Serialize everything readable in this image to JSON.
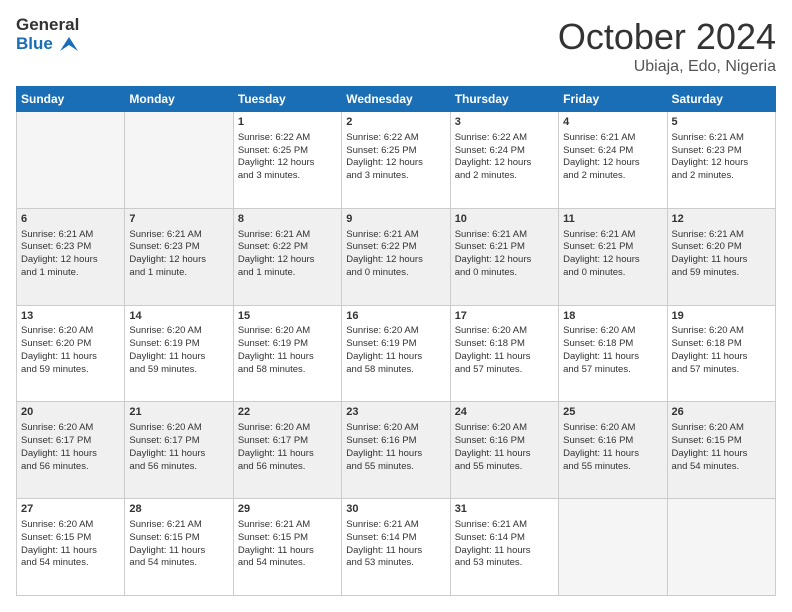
{
  "header": {
    "logo_line1": "General",
    "logo_line2": "Blue",
    "month": "October 2024",
    "location": "Ubiaja, Edo, Nigeria"
  },
  "days_of_week": [
    "Sunday",
    "Monday",
    "Tuesday",
    "Wednesday",
    "Thursday",
    "Friday",
    "Saturday"
  ],
  "weeks": [
    [
      {
        "day": "",
        "empty": true
      },
      {
        "day": "",
        "empty": true
      },
      {
        "day": "1",
        "line1": "Sunrise: 6:22 AM",
        "line2": "Sunset: 6:25 PM",
        "line3": "Daylight: 12 hours",
        "line4": "and 3 minutes."
      },
      {
        "day": "2",
        "line1": "Sunrise: 6:22 AM",
        "line2": "Sunset: 6:25 PM",
        "line3": "Daylight: 12 hours",
        "line4": "and 3 minutes."
      },
      {
        "day": "3",
        "line1": "Sunrise: 6:22 AM",
        "line2": "Sunset: 6:24 PM",
        "line3": "Daylight: 12 hours",
        "line4": "and 2 minutes."
      },
      {
        "day": "4",
        "line1": "Sunrise: 6:21 AM",
        "line2": "Sunset: 6:24 PM",
        "line3": "Daylight: 12 hours",
        "line4": "and 2 minutes."
      },
      {
        "day": "5",
        "line1": "Sunrise: 6:21 AM",
        "line2": "Sunset: 6:23 PM",
        "line3": "Daylight: 12 hours",
        "line4": "and 2 minutes."
      }
    ],
    [
      {
        "day": "6",
        "line1": "Sunrise: 6:21 AM",
        "line2": "Sunset: 6:23 PM",
        "line3": "Daylight: 12 hours",
        "line4": "and 1 minute."
      },
      {
        "day": "7",
        "line1": "Sunrise: 6:21 AM",
        "line2": "Sunset: 6:23 PM",
        "line3": "Daylight: 12 hours",
        "line4": "and 1 minute."
      },
      {
        "day": "8",
        "line1": "Sunrise: 6:21 AM",
        "line2": "Sunset: 6:22 PM",
        "line3": "Daylight: 12 hours",
        "line4": "and 1 minute."
      },
      {
        "day": "9",
        "line1": "Sunrise: 6:21 AM",
        "line2": "Sunset: 6:22 PM",
        "line3": "Daylight: 12 hours",
        "line4": "and 0 minutes."
      },
      {
        "day": "10",
        "line1": "Sunrise: 6:21 AM",
        "line2": "Sunset: 6:21 PM",
        "line3": "Daylight: 12 hours",
        "line4": "and 0 minutes."
      },
      {
        "day": "11",
        "line1": "Sunrise: 6:21 AM",
        "line2": "Sunset: 6:21 PM",
        "line3": "Daylight: 12 hours",
        "line4": "and 0 minutes."
      },
      {
        "day": "12",
        "line1": "Sunrise: 6:21 AM",
        "line2": "Sunset: 6:20 PM",
        "line3": "Daylight: 11 hours",
        "line4": "and 59 minutes."
      }
    ],
    [
      {
        "day": "13",
        "line1": "Sunrise: 6:20 AM",
        "line2": "Sunset: 6:20 PM",
        "line3": "Daylight: 11 hours",
        "line4": "and 59 minutes."
      },
      {
        "day": "14",
        "line1": "Sunrise: 6:20 AM",
        "line2": "Sunset: 6:19 PM",
        "line3": "Daylight: 11 hours",
        "line4": "and 59 minutes."
      },
      {
        "day": "15",
        "line1": "Sunrise: 6:20 AM",
        "line2": "Sunset: 6:19 PM",
        "line3": "Daylight: 11 hours",
        "line4": "and 58 minutes."
      },
      {
        "day": "16",
        "line1": "Sunrise: 6:20 AM",
        "line2": "Sunset: 6:19 PM",
        "line3": "Daylight: 11 hours",
        "line4": "and 58 minutes."
      },
      {
        "day": "17",
        "line1": "Sunrise: 6:20 AM",
        "line2": "Sunset: 6:18 PM",
        "line3": "Daylight: 11 hours",
        "line4": "and 57 minutes."
      },
      {
        "day": "18",
        "line1": "Sunrise: 6:20 AM",
        "line2": "Sunset: 6:18 PM",
        "line3": "Daylight: 11 hours",
        "line4": "and 57 minutes."
      },
      {
        "day": "19",
        "line1": "Sunrise: 6:20 AM",
        "line2": "Sunset: 6:18 PM",
        "line3": "Daylight: 11 hours",
        "line4": "and 57 minutes."
      }
    ],
    [
      {
        "day": "20",
        "line1": "Sunrise: 6:20 AM",
        "line2": "Sunset: 6:17 PM",
        "line3": "Daylight: 11 hours",
        "line4": "and 56 minutes."
      },
      {
        "day": "21",
        "line1": "Sunrise: 6:20 AM",
        "line2": "Sunset: 6:17 PM",
        "line3": "Daylight: 11 hours",
        "line4": "and 56 minutes."
      },
      {
        "day": "22",
        "line1": "Sunrise: 6:20 AM",
        "line2": "Sunset: 6:17 PM",
        "line3": "Daylight: 11 hours",
        "line4": "and 56 minutes."
      },
      {
        "day": "23",
        "line1": "Sunrise: 6:20 AM",
        "line2": "Sunset: 6:16 PM",
        "line3": "Daylight: 11 hours",
        "line4": "and 55 minutes."
      },
      {
        "day": "24",
        "line1": "Sunrise: 6:20 AM",
        "line2": "Sunset: 6:16 PM",
        "line3": "Daylight: 11 hours",
        "line4": "and 55 minutes."
      },
      {
        "day": "25",
        "line1": "Sunrise: 6:20 AM",
        "line2": "Sunset: 6:16 PM",
        "line3": "Daylight: 11 hours",
        "line4": "and 55 minutes."
      },
      {
        "day": "26",
        "line1": "Sunrise: 6:20 AM",
        "line2": "Sunset: 6:15 PM",
        "line3": "Daylight: 11 hours",
        "line4": "and 54 minutes."
      }
    ],
    [
      {
        "day": "27",
        "line1": "Sunrise: 6:20 AM",
        "line2": "Sunset: 6:15 PM",
        "line3": "Daylight: 11 hours",
        "line4": "and 54 minutes."
      },
      {
        "day": "28",
        "line1": "Sunrise: 6:21 AM",
        "line2": "Sunset: 6:15 PM",
        "line3": "Daylight: 11 hours",
        "line4": "and 54 minutes."
      },
      {
        "day": "29",
        "line1": "Sunrise: 6:21 AM",
        "line2": "Sunset: 6:15 PM",
        "line3": "Daylight: 11 hours",
        "line4": "and 54 minutes."
      },
      {
        "day": "30",
        "line1": "Sunrise: 6:21 AM",
        "line2": "Sunset: 6:14 PM",
        "line3": "Daylight: 11 hours",
        "line4": "and 53 minutes."
      },
      {
        "day": "31",
        "line1": "Sunrise: 6:21 AM",
        "line2": "Sunset: 6:14 PM",
        "line3": "Daylight: 11 hours",
        "line4": "and 53 minutes."
      },
      {
        "day": "",
        "empty": true
      },
      {
        "day": "",
        "empty": true
      }
    ]
  ]
}
